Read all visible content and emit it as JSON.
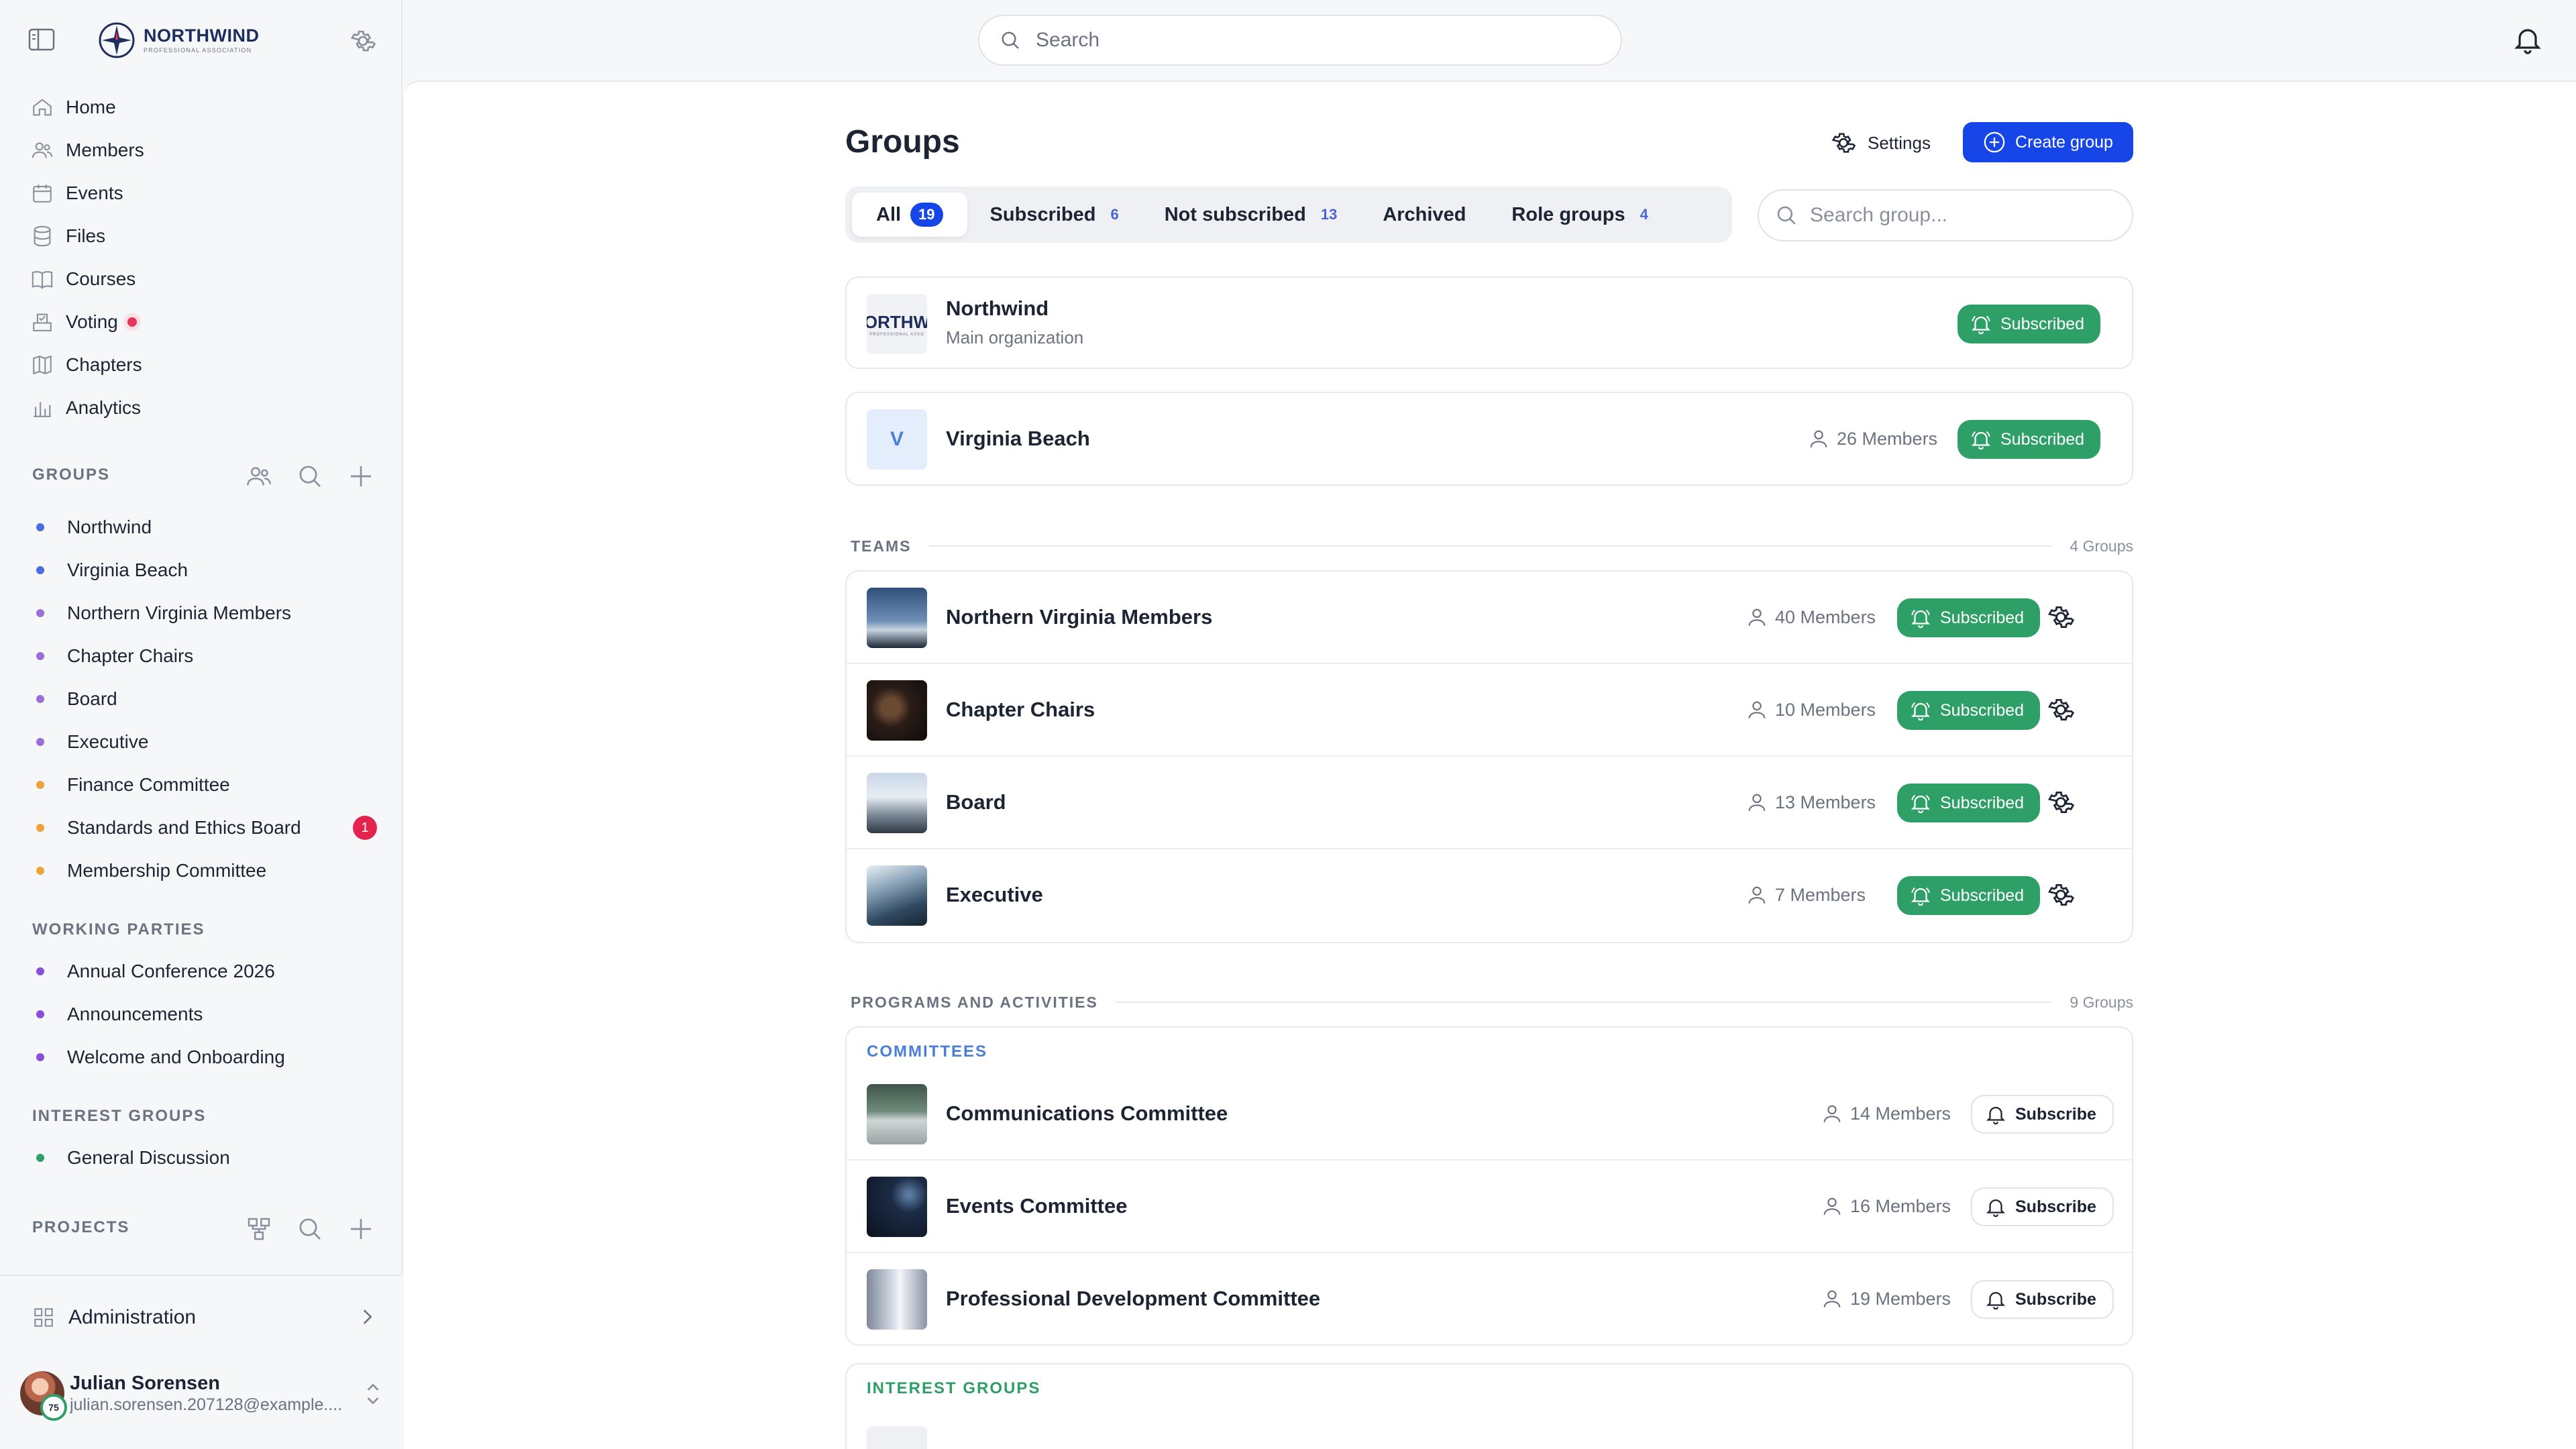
{
  "brand": {
    "name": "NORTHWIND",
    "sub": "PROFESSIONAL ASSOCIATION"
  },
  "topbar": {
    "search_placeholder": "Search"
  },
  "nav": [
    {
      "label": "Home",
      "icon": "home-icon"
    },
    {
      "label": "Members",
      "icon": "users-icon"
    },
    {
      "label": "Events",
      "icon": "calendar-icon"
    },
    {
      "label": "Files",
      "icon": "database-icon"
    },
    {
      "label": "Courses",
      "icon": "book-icon"
    },
    {
      "label": "Voting",
      "icon": "ballot-icon"
    },
    {
      "label": "Chapters",
      "icon": "map-icon"
    },
    {
      "label": "Analytics",
      "icon": "chart-icon"
    }
  ],
  "sidebar": {
    "groups_label": "GROUPS",
    "groups": [
      {
        "label": "Northwind",
        "color": "#4a6ee0"
      },
      {
        "label": "Virginia Beach",
        "color": "#4a6ee0"
      },
      {
        "label": "Northern Virginia Members",
        "color": "#9b6fd9"
      },
      {
        "label": "Chapter Chairs",
        "color": "#9b6fd9"
      },
      {
        "label": "Board",
        "color": "#9b6fd9"
      },
      {
        "label": "Executive",
        "color": "#9b6fd9"
      },
      {
        "label": "Finance Committee",
        "color": "#f0a23a"
      },
      {
        "label": "Standards and Ethics Board",
        "color": "#f0a23a",
        "badge": "1"
      },
      {
        "label": "Membership Committee",
        "color": "#f0a23a"
      }
    ],
    "working_label": "WORKING PARTIES",
    "working": [
      {
        "label": "Annual Conference 2026",
        "color": "#8a4fd9"
      },
      {
        "label": "Announcements",
        "color": "#8a4fd9"
      },
      {
        "label": "Welcome and Onboarding",
        "color": "#8a4fd9"
      }
    ],
    "interest_label": "INTEREST GROUPS",
    "interest": [
      {
        "label": "General Discussion",
        "color": "#2e9f66"
      }
    ],
    "projects_label": "PROJECTS",
    "admin_label": "Administration",
    "user": {
      "name": "Julian Sorensen",
      "email": "julian.sorensen.207128@example....",
      "level": "75"
    }
  },
  "main": {
    "title": "Groups",
    "settings_label": "Settings",
    "create_label": "Create group",
    "search_placeholder": "Search group...",
    "tabs": [
      {
        "label": "All",
        "count": "19"
      },
      {
        "label": "Subscribed",
        "count": "6"
      },
      {
        "label": "Not subscribed",
        "count": "13"
      },
      {
        "label": "Archived",
        "count": ""
      },
      {
        "label": "Role groups",
        "count": "4"
      }
    ],
    "org": {
      "title": "Northwind",
      "subtitle": "Main organization",
      "status": "Subscribed",
      "logo_text": "ORTHW",
      "logo_sub": "PROFESSIONAL ASSO"
    },
    "vb": {
      "title": "Virginia Beach",
      "initial": "V",
      "members": "26 Members",
      "status": "Subscribed"
    },
    "teams": {
      "label": "TEAMS",
      "count": "4 Groups",
      "rows": [
        {
          "title": "Northern Virginia Members",
          "members": "40 Members",
          "status": "Subscribed"
        },
        {
          "title": "Chapter Chairs",
          "members": "10 Members",
          "status": "Subscribed"
        },
        {
          "title": "Board",
          "members": "13 Members",
          "status": "Subscribed"
        },
        {
          "title": "Executive",
          "members": "7 Members",
          "status": "Subscribed"
        }
      ]
    },
    "programs": {
      "label": "PROGRAMS AND ACTIVITIES",
      "count": "9 Groups",
      "committees_label": "COMMITTEES",
      "rows": [
        {
          "title": "Communications Committee",
          "members": "14 Members",
          "action": "Subscribe"
        },
        {
          "title": "Events Committee",
          "members": "16 Members",
          "action": "Subscribe"
        },
        {
          "title": "Professional Development Committee",
          "members": "19 Members",
          "action": "Subscribe"
        }
      ],
      "interest_label": "INTEREST GROUPS"
    }
  },
  "colors": {
    "accent": "#1746e8",
    "subscribed": "#2e9f66",
    "committees": "#4a7fd6",
    "interest": "#2e9f66"
  }
}
